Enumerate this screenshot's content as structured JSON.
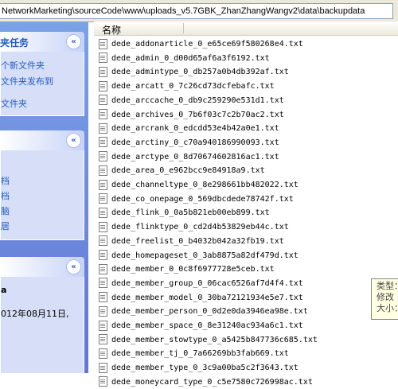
{
  "address_bar": {
    "path": "NetworkMarketing\\sourceCode\\www\\uploads_v5.7GBK_ZhanZhangWangv2\\data\\backupdata"
  },
  "task_pane": {
    "file_tasks": {
      "title": "夹任务",
      "collapse_glyph": "«",
      "links": [
        "个新文件夹",
        "文件夹发布到",
        "文件夹"
      ]
    },
    "other_places": {
      "collapse_glyph": "«",
      "links": [
        "档",
        "档",
        "脑",
        "居"
      ]
    },
    "details": {
      "collapse_glyph": "«",
      "name": "a",
      "modified": "012年08月11日,"
    }
  },
  "file_list": {
    "column_header": "名称",
    "files": [
      "dede_addonarticle_0_e65ce69f580268e4.txt",
      "dede_admin_0_d00d65af6a3f6192.txt",
      "dede_admintype_0_db257a0b4db392af.txt",
      "dede_arcatt_0_7c26cd73dcfebafc.txt",
      "dede_arccache_0_db9c259290e531d1.txt",
      "dede_archives_0_7b6f03c7c2b70ac2.txt",
      "dede_arcrank_0_edcdd53e4b42a0e1.txt",
      "dede_arctiny_0_c70a940186990093.txt",
      "dede_arctype_0_8d70674602816ac1.txt",
      "dede_area_0_e962bcc9e84918a9.txt",
      "dede_channeltype_0_8e298661bb482022.txt",
      "dede_co_onepage_0_569dbcdede78742f.txt",
      "dede_flink_0_0a5b821eb00eb899.txt",
      "dede_flinktype_0_cd2d4b53829eb44c.txt",
      "dede_freelist_0_b4032b042a32fb19.txt",
      "dede_homepageset_0_3ab8875a82df479d.txt",
      "dede_member_0_0c8f6977728e5ceb.txt",
      "dede_member_group_0_06cac6526af7d4f4.txt",
      "dede_member_model_0_30ba72121934e5e7.txt",
      "dede_member_person_0_0d2e0da3946ea98e.txt",
      "dede_member_space_0_8e31240ac934a6c1.txt",
      "dede_member_stowtype_0_a5425b847736c685.txt",
      "dede_member_tj_0_7a66269bb3fab669.txt",
      "dede_member_type_0_3c9a00ba5c2f3643.txt",
      "dede_moneycard_type_0_c5e7580c726998ac.txt"
    ]
  },
  "tooltip": {
    "lines": [
      "类型：",
      "修改",
      "大小："
    ]
  }
}
